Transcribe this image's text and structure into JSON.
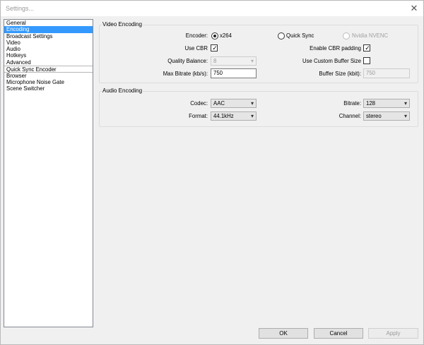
{
  "window": {
    "title": "Settings...",
    "close_glyph": "✕"
  },
  "sidebar": {
    "items": [
      "General",
      "Encoding",
      "Broadcast Settings",
      "Video",
      "Audio",
      "Hotkeys",
      "Advanced"
    ],
    "selected": "Encoding",
    "section_header": "Quick Sync Encoder",
    "plugins": [
      "Browser",
      "Microphone Noise Gate",
      "Scene Switcher"
    ]
  },
  "video_encoding": {
    "title": "Video Encoding",
    "encoder_label": "Encoder:",
    "encoder_options": [
      "x264",
      "Quick Sync",
      "Nvidia NVENC"
    ],
    "encoder_selected": "x264",
    "use_cbr_label": "Use CBR",
    "use_cbr_checked": true,
    "enable_cbr_padding_label": "Enable CBR padding",
    "enable_cbr_padding_checked": true,
    "quality_balance_label": "Quality Balance:",
    "quality_balance_value": "8",
    "use_custom_buffer_label": "Use Custom Buffer Size",
    "use_custom_buffer_checked": false,
    "max_bitrate_label": "Max Bitrate (kb/s):",
    "max_bitrate_value": "750",
    "buffer_size_label": "Buffer Size (kbit):",
    "buffer_size_value": "750"
  },
  "audio_encoding": {
    "title": "Audio Encoding",
    "codec_label": "Codec:",
    "codec_value": "AAC",
    "bitrate_label": "Bitrate:",
    "bitrate_value": "128",
    "format_label": "Format:",
    "format_value": "44.1kHz",
    "channel_label": "Channel:",
    "channel_value": "stereo"
  },
  "buttons": {
    "ok": "OK",
    "cancel": "Cancel",
    "apply": "Apply"
  },
  "icons": {
    "dropdown": "▾",
    "check": "✓"
  },
  "colors": {
    "selection": "#3399ff"
  }
}
